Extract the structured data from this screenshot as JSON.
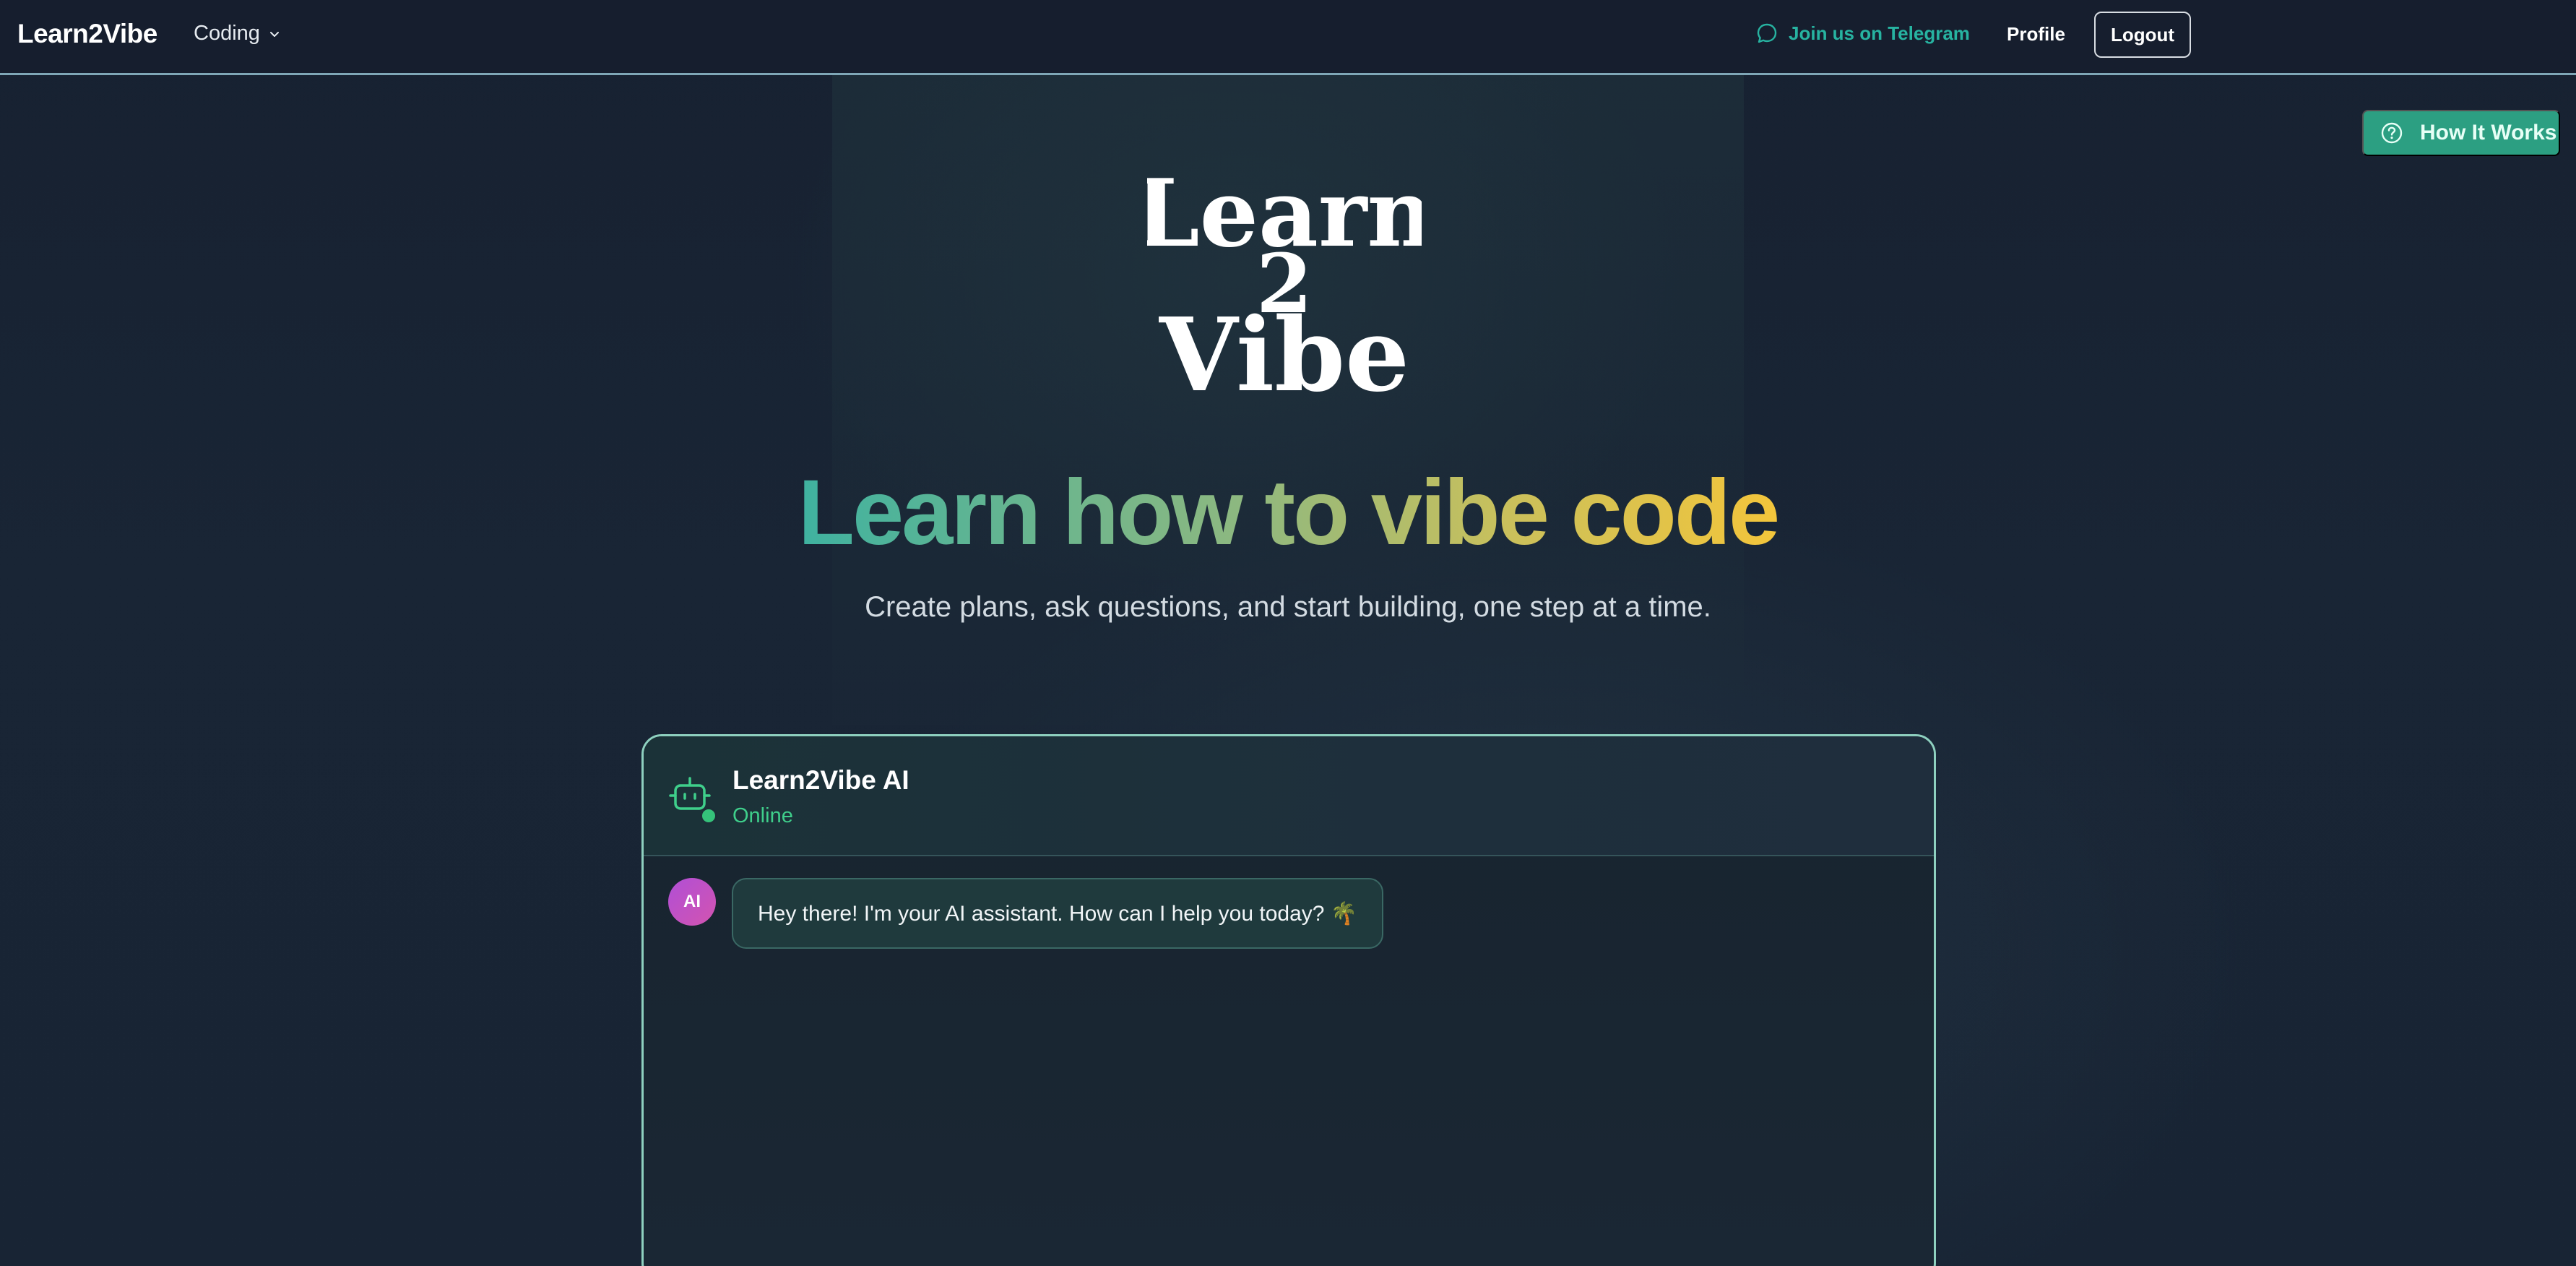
{
  "nav": {
    "brand": "Learn2Vibe",
    "menu_label": "Coding",
    "telegram_label": "Join us on Telegram",
    "profile_label": "Profile",
    "logout_label": "Logout"
  },
  "help_button": {
    "label": "How It Works"
  },
  "logo": {
    "text_lines": [
      "Learn",
      "2",
      "Vibe"
    ]
  },
  "hero": {
    "title": "Learn how to vibe code",
    "subtitle": "Create plans, ask questions, and start building, one step at a time."
  },
  "chat": {
    "title": "Learn2Vibe AI",
    "status": "Online",
    "messages": [
      {
        "sender": "AI",
        "text": "Hey there! I'm your AI assistant. How can I help you today? 🌴"
      }
    ]
  },
  "colors": {
    "accent": "#2c9f82",
    "telegram": "#27b3a1",
    "online": "#3fcf8b",
    "gradient_start": "#3fb2a0",
    "gradient_end": "#f3c53b",
    "avatar": "#b04fd6"
  },
  "icons": {
    "menu_chevron": "chevron-down-icon",
    "telegram": "chat-bubble-icon",
    "help": "question-circle-icon",
    "bot": "robot-icon"
  }
}
